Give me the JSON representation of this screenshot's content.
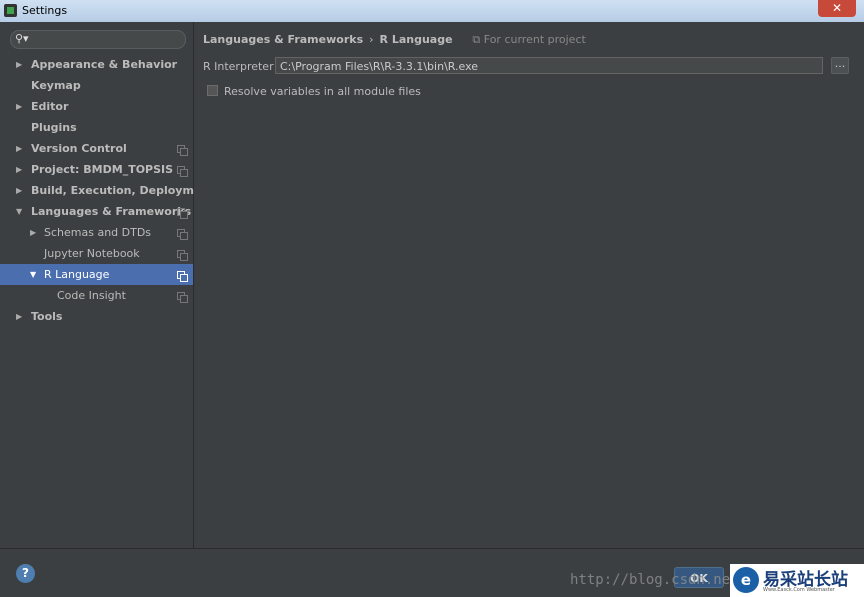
{
  "window": {
    "title": "Settings",
    "close_glyph": "✕"
  },
  "search": {
    "placeholder": ""
  },
  "tree": [
    {
      "label": "Appearance & Behavior",
      "arrow": "▶"
    },
    {
      "label": "Keymap",
      "arrow": ""
    },
    {
      "label": "Editor",
      "arrow": "▶"
    },
    {
      "label": "Plugins",
      "arrow": ""
    },
    {
      "label": "Version Control",
      "arrow": "▶"
    },
    {
      "label": "Project: BMDM_TOPSIS",
      "arrow": "▶"
    },
    {
      "label": "Build, Execution, Deployment",
      "arrow": "▶"
    },
    {
      "label": "Languages & Frameworks",
      "arrow": "▼"
    },
    {
      "label": "Schemas and DTDs",
      "arrow": "▶"
    },
    {
      "label": "Jupyter Notebook",
      "arrow": ""
    },
    {
      "label": "R Language",
      "arrow": "▼"
    },
    {
      "label": "Code Insight",
      "arrow": ""
    },
    {
      "label": "Tools",
      "arrow": "▶"
    }
  ],
  "breadcrumb": {
    "parent": "Languages & Frameworks",
    "separator": "›",
    "current": "R Language",
    "scope": "For current project"
  },
  "interpreter": {
    "label": "R Interpreter :",
    "value": "C:\\Program Files\\R\\R-3.3.1\\bin\\R.exe",
    "browse_label": "..."
  },
  "resolve_checkbox": {
    "label": "Resolve variables in all module files",
    "checked": false
  },
  "footer": {
    "help_label": "?",
    "ok_label": "OK"
  },
  "watermark": "http://blog.csdn.ne",
  "logo": {
    "mark": "e",
    "text": "易采站长站",
    "sub": "Www.Easck.Com Webmaster"
  }
}
